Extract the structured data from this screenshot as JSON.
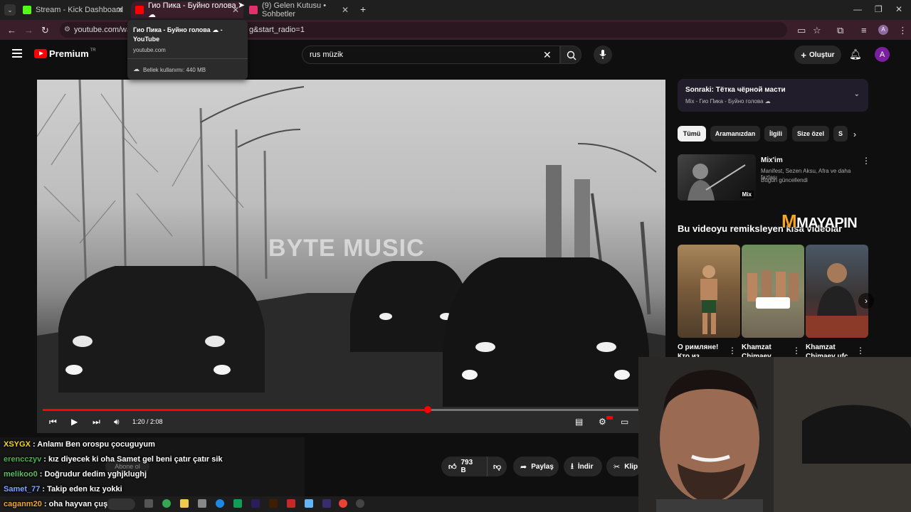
{
  "browser": {
    "tabs": [
      {
        "label": "Stream - Kick Dashboard",
        "color": "#53fc18"
      },
      {
        "label": "Гио Пика - Буйно голова ☁",
        "color": "#ff0000"
      },
      {
        "label": "(9) Gelen Kutusu • Sohbetler",
        "color": "#e1306c"
      }
    ],
    "new_tab": "+",
    "address": "youtube.com/wat",
    "address_tail": "g&start_radio=1",
    "tooltip": {
      "title": "Гио Пика - Буйно голова ☁ - YouTube",
      "domain": "youtube.com",
      "memory": "Bellek kullanımı: 440 MB"
    },
    "profile_initial": "A"
  },
  "youtube": {
    "logo_text": "Premium",
    "region": "TR",
    "search_value": "rus müzik",
    "create_label": "Oluştur",
    "avatar_initial": "A"
  },
  "player": {
    "time": "1:20 / 2:08",
    "progress": 0.646,
    "watermark": "BYTE MUSIC",
    "accent": "#ff0000"
  },
  "actions": {
    "likes": "793 B",
    "share": "Paylaş",
    "download": "İndir",
    "clip": "Klip",
    "subscribe": "Abone ol"
  },
  "sidebar": {
    "up_next_title": "Sonraki: Тётка чёрной масти",
    "up_next_sub": "Mix - Гио Пика - Буйно голова ☁",
    "chips": [
      "Tümü",
      "Aramanızdan",
      "İlgili",
      "Size özel",
      "S"
    ],
    "mix": {
      "title": "Mix'im",
      "subtitle": "Manifest, Sezen Aksu, Afra ve daha fazlası",
      "updated": "Bugün güncellendi",
      "badge": "Mix"
    },
    "remix_heading": "Bu videoyu remiksleyen kısa videolar",
    "shorts": [
      {
        "title": "O римляне! Кто из"
      },
      {
        "title": "Khamzat Chimaev"
      },
      {
        "title": "Khamzat Chimaev ufc"
      }
    ]
  },
  "overlay": {
    "brand": "MAYAPIN"
  },
  "chat": [
    {
      "user": "XSYGX",
      "msg": "Anlamı Ben orospu çocuguyum",
      "color": "#f5d90a"
    },
    {
      "user": "erencczyv",
      "msg": "kız diyecek ki oha Samet gel beni çatır çatır sik",
      "color": "#4caf50"
    },
    {
      "user": "melikoo0",
      "msg": "Doğrudur dedim yghjklughj",
      "color": "#66bb6a"
    },
    {
      "user": "Samet_77",
      "msg": "Takip eden kız yokki",
      "color": "#7aa7ff"
    },
    {
      "user": "caganm20",
      "msg": "oha hayvan çuş",
      "color": "#f5a623"
    }
  ]
}
